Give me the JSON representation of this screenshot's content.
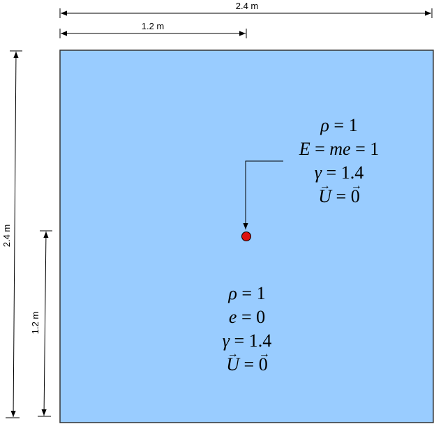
{
  "dimensions": {
    "top_full": "2.4 m",
    "top_half": "1.2 m",
    "left_full": "2.4 m",
    "left_half": "1.2 m"
  },
  "region_colors": {
    "domain_fill": "#99ccff",
    "domain_border": "#333333",
    "point_fill": "#dd1111"
  },
  "upper_conditions": {
    "rho_lhs": "ρ",
    "rho_rhs": "= 1",
    "energy_lhs": "E",
    "energy_mid": "=",
    "energy_me": "me",
    "energy_rhs": "= 1",
    "gamma_lhs": "γ",
    "gamma_rhs": "= 1.4",
    "velocity_lhs": "U",
    "velocity_eq": "=",
    "velocity_rhs": "0"
  },
  "lower_conditions": {
    "rho_lhs": "ρ",
    "rho_rhs": "= 1",
    "energy_lhs": "e",
    "energy_rhs": "= 0",
    "gamma_lhs": "γ",
    "gamma_rhs": "= 1.4",
    "velocity_lhs": "U",
    "velocity_eq": "=",
    "velocity_rhs": "0"
  }
}
